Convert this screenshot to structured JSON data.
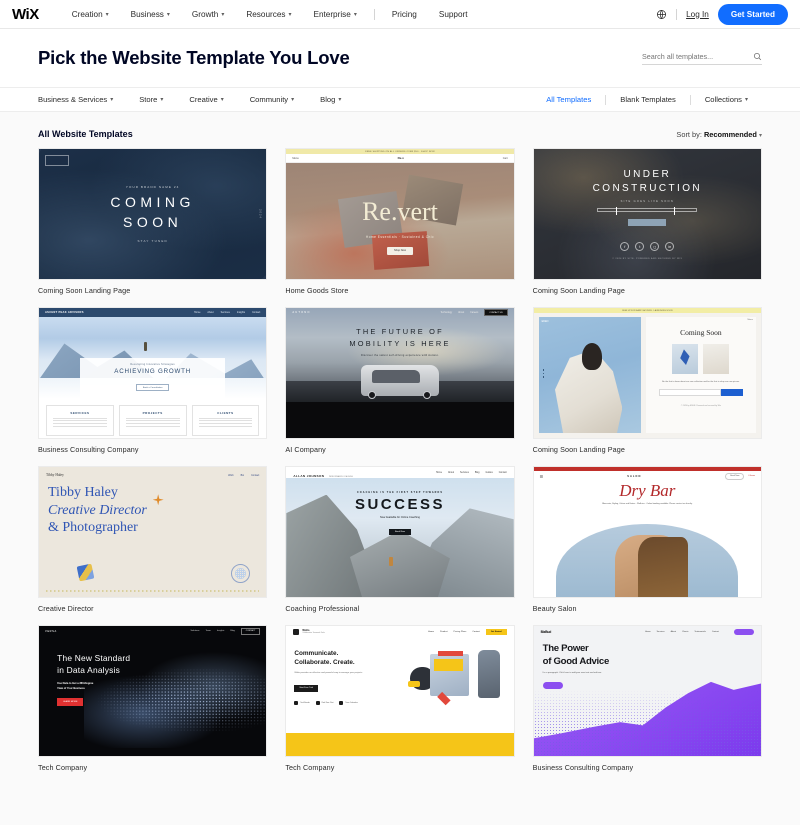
{
  "header": {
    "logo": "WiX",
    "nav": [
      {
        "label": "Creation",
        "has_caret": true
      },
      {
        "label": "Business",
        "has_caret": true
      },
      {
        "label": "Growth",
        "has_caret": true
      },
      {
        "label": "Resources",
        "has_caret": true
      },
      {
        "label": "Enterprise",
        "has_caret": true
      },
      {
        "label": "Pricing",
        "has_caret": false
      },
      {
        "label": "Support",
        "has_caret": false
      }
    ],
    "globe_icon": "globe-icon",
    "login": "Log In",
    "cta": "Get Started",
    "cta_color": "#116dff"
  },
  "title_bar": {
    "title": "Pick the Website Template You Love",
    "search_placeholder": "Search all templates...",
    "search_value": "",
    "search_icon": "search-icon"
  },
  "subnav": {
    "categories": [
      {
        "label": "Business & Services",
        "has_caret": true
      },
      {
        "label": "Store",
        "has_caret": true
      },
      {
        "label": "Creative",
        "has_caret": true
      },
      {
        "label": "Community",
        "has_caret": true
      },
      {
        "label": "Blog",
        "has_caret": true
      }
    ],
    "links": [
      {
        "label": "All Templates",
        "active": true,
        "has_caret": false
      },
      {
        "label": "Blank Templates",
        "active": false,
        "has_caret": false
      },
      {
        "label": "Collections",
        "active": false,
        "has_caret": true
      }
    ],
    "active_color": "#116dff"
  },
  "main": {
    "section_title": "All Website Templates",
    "sort_label": "Sort by:",
    "sort_value": "Recommended",
    "sort_caret": "chevron-down-icon"
  },
  "templates": [
    {
      "label": "Coming Soon Landing Page",
      "art": {
        "kicker": "YOUR BRAND NAME 24",
        "headline_1": "COMING",
        "headline_2": "SOON",
        "subline": "STAY TUNED",
        "side_text": "2024"
      }
    },
    {
      "label": "Home Goods Store",
      "art": {
        "announcement": "FREE SHIPPING ON ALL ORDERS OVER $50 · SHOP NOW",
        "nav_left": "Menu",
        "nav_center": "Re.v",
        "nav_right": "Cart",
        "wordmark": "Re.vert",
        "tagline": "Home Essentials · Sustained & Chic",
        "button": "Shop Now"
      }
    },
    {
      "label": "Coming Soon Landing Page",
      "art": {
        "headline_1": "UNDER",
        "headline_2": "CONSTRUCTION",
        "subline": "SITE GOES LIVE SOON",
        "button": "",
        "socials": [
          "f",
          "t",
          "ig",
          "in"
        ],
        "footer": "© 2024 BY SITE. POWERED AND SECURED BY WIX"
      }
    },
    {
      "label": "Business Consulting Company",
      "art": {
        "logo": "ASCENT PEAK ADVISORS",
        "nav": [
          "Home",
          "About",
          "Services",
          "Insights",
          "Contact"
        ],
        "kicker": "Developing Innovative Strategies",
        "headline": "ACHIEVING GROWTH",
        "button": "Book a Consultation",
        "columns": [
          "SERVICES",
          "PROJECTS",
          "CLIENTS"
        ]
      }
    },
    {
      "label": "AI Company",
      "art": {
        "logo": "AUTONO",
        "nav": [
          "Technology",
          "About",
          "Careers"
        ],
        "nav_button": "CONTACT US",
        "headline_1": "THE FUTURE OF",
        "headline_2": "MOBILITY IS HERE",
        "subline": "Discover the safest self-driving experience with Autono."
      }
    },
    {
      "label": "Coming Soon Landing Page",
      "art": {
        "announcement": "SIGN UP FOR EARLY ACCESS · LAUNCHING SOON",
        "logo": "EDEN",
        "menu": "Menu",
        "headline": "Coming Soon",
        "newsletter_text": "Be the first to know about our new collection and be the first to shop our new pieces.",
        "input_placeholder": "Email",
        "footer": "© 2024 by EDEN. Powered and secured by Wix"
      }
    },
    {
      "label": "Creative Director",
      "art": {
        "logo": "Tibby Haley",
        "nav": [
          "Work",
          "Bio",
          "Contact"
        ],
        "headline_1": "Tibby Haley",
        "headline_2": "Creative Director",
        "headline_3": "& Photographer"
      }
    },
    {
      "label": "Coaching Professional",
      "art": {
        "logo": "ALLAN JOHNSON",
        "logo_sub": "PERFORMANCE COACHING",
        "nav": [
          "Home",
          "About",
          "Services",
          "Blog",
          "Guides",
          "Contact"
        ],
        "kicker": "COACHING IS THE FIRST STEP TOWARDS",
        "headline": "SUCCESS",
        "subline": "Now Available for Online Coaching",
        "button": "Book Now"
      }
    },
    {
      "label": "Beauty Salon",
      "art": {
        "logo": "SALON",
        "wordmark": "Dry Bar",
        "subline": "Blow-outs, Styling, Colour and Extras · Walk-ins · Online booking available. Please contact us directly.",
        "pill": "Book Now",
        "cart": "0 Items"
      }
    },
    {
      "label": "Tech Company",
      "art": {
        "logo": "VERSA",
        "nav": [
          "Solutions",
          "Team",
          "Insights",
          "Blog"
        ],
        "nav_button": "CONTACT",
        "headline_1": "The New Standard",
        "headline_2": "in Data Analysis",
        "subline_1": "Use Data to Get a 360-Degree",
        "subline_2": "View of Your Business",
        "button": "LEARN MORE"
      }
    },
    {
      "label": "Tech Company",
      "art": {
        "logo": "Wolto",
        "logo_sub": "Collaborative Teamwork Tools",
        "nav": [
          "Home",
          "Product",
          "Pricing Plans",
          "Contact"
        ],
        "nav_button": "Get Started",
        "headline_1": "Communicate.",
        "headline_2": "Collaborate. Create.",
        "subline": "Wolto provides an effective and powerful way to manage your projects.",
        "button": "Start Free Trial",
        "features": [
          "Task Boards",
          "Real-Time Chat",
          "Team Calendars"
        ]
      }
    },
    {
      "label": "Business Consulting Company",
      "art": {
        "logo": "BizBud",
        "nav": [
          "Home",
          "Services",
          "About",
          "Clients",
          "Testimonials",
          "Contact"
        ],
        "headline_1": "The Power",
        "headline_2": "of Good Advice",
        "subline": "I'm a paragraph. Click here to add your own text and edit me.",
        "accent_color": "#8c4ff0"
      }
    }
  ]
}
